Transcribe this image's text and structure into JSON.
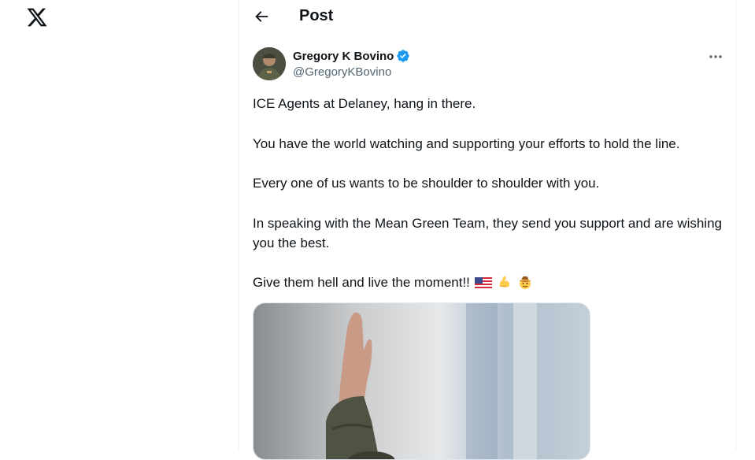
{
  "header": {
    "title": "Post"
  },
  "author": {
    "name": "Gregory K Bovino",
    "handle": "@GregoryKBovino"
  },
  "tweet": {
    "paragraphs": [
      "ICE Agents at Delaney, hang in there.",
      "You have the world watching and supporting your efforts to hold the line.",
      "Every one of us wants to be shoulder to shoulder with you.",
      "In speaking with the Mean Green Team, they send you support and are wishing you the best.",
      "Give them hell and live the moment!!"
    ],
    "emojis": [
      "us-flag-icon",
      "flexed-biceps-icon",
      "cowboy-hat-face-icon"
    ]
  },
  "colors": {
    "verified": "#1d9bf0",
    "text": "#0f1419",
    "secondary": "#536471",
    "border": "#eff3f4"
  }
}
